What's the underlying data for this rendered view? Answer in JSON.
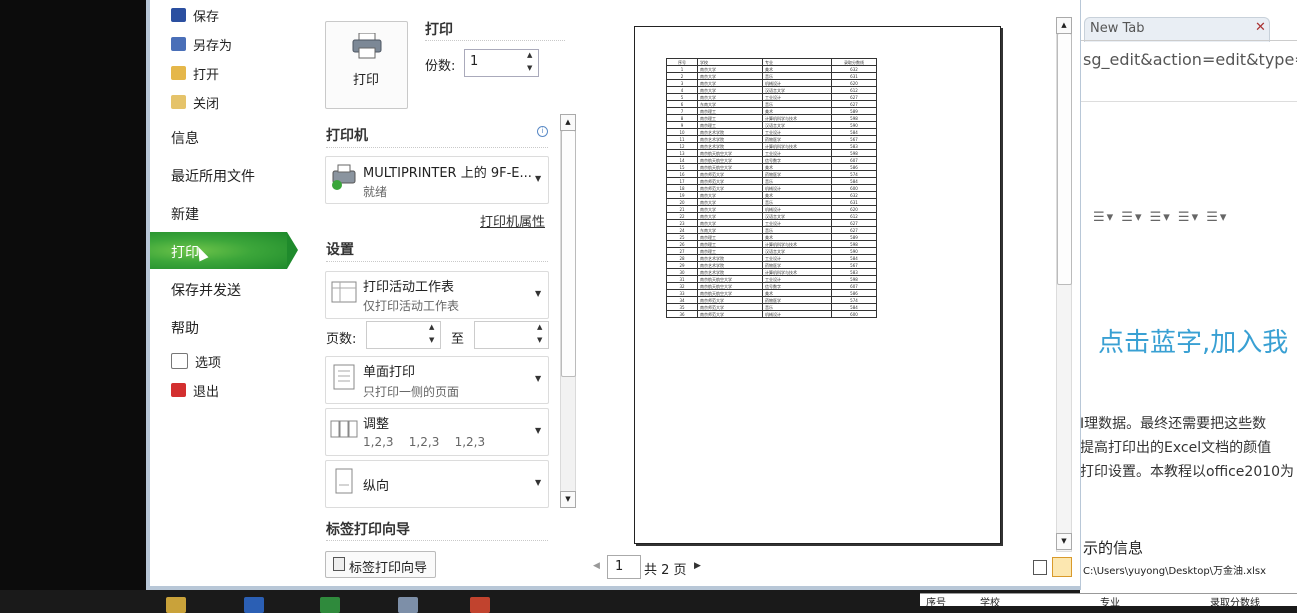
{
  "nav": {
    "save": "保存",
    "save_as": "另存为",
    "open": "打开",
    "close": "关闭",
    "info": "信息",
    "recent": "最近所用文件",
    "new": "新建",
    "print": "打印",
    "save_send": "保存并发送",
    "help": "帮助",
    "options": "选项",
    "exit": "退出"
  },
  "print": {
    "button_label": "打印",
    "header": "打印",
    "copies_label": "份数:",
    "copies_value": "1"
  },
  "printer": {
    "header": "打印机",
    "name": "MULTIPRINTER 上的 9F-E...",
    "status": "就绪",
    "properties_link": "打印机属性"
  },
  "settings": {
    "header": "设置",
    "scope_title": "打印活动工作表",
    "scope_sub": "仅打印活动工作表",
    "pages_label": "页数:",
    "pages_to": "至",
    "sides_title": "单面打印",
    "sides_sub": "只打印一侧的页面",
    "collate_title": "调整",
    "collate_sub": "1,2,3    1,2,3    1,2,3",
    "orientation_title": "纵向"
  },
  "label_wizard": {
    "header": "标签打印向导",
    "button": "标签打印向导"
  },
  "preview": {
    "current_page": "1",
    "total_pages": "共 2 页"
  },
  "background_window": {
    "tab_label": "New Tab",
    "url": "sg_edit&action=edit&type=",
    "blue_text": "点击蓝字,加入我",
    "para1": "I理数据。最终还需要把这些数",
    "para2": "提高打印出的Excel文档的颜值",
    "para3": "打印设置。本教程以office2010为",
    "info": "示的信息",
    "path": "C:\\Users\\yuyong\\Desktop\\万金油.xlsx",
    "table_headers": [
      "序号",
      "学校",
      "专业",
      "录取分数线"
    ]
  },
  "preview_table": {
    "headers": [
      "序号",
      "学校",
      "专业",
      "录取分数线"
    ],
    "rows": [
      [
        "1",
        "南京大学",
        "美术",
        "632"
      ],
      [
        "2",
        "南京大学",
        "音乐",
        "631"
      ],
      [
        "3",
        "南京大学",
        "机械设计",
        "620"
      ],
      [
        "4",
        "南京大学",
        "汉语言文学",
        "612"
      ],
      [
        "5",
        "南京大学",
        "工业设计",
        "627"
      ],
      [
        "6",
        "东南大学",
        "音乐",
        "627"
      ],
      [
        "7",
        "南京理工",
        "美术",
        "589"
      ],
      [
        "8",
        "南京理工",
        "计算机科学与技术",
        "598"
      ],
      [
        "9",
        "南京理工",
        "汉语言文学",
        "590"
      ],
      [
        "10",
        "南京艺术学院",
        "工业设计",
        "584"
      ],
      [
        "11",
        "南京艺术学院",
        "药物医学",
        "567"
      ],
      [
        "12",
        "南京艺术学院",
        "计算机科学与技术",
        "583"
      ],
      [
        "13",
        "南京航天航空大学",
        "工业设计",
        "598"
      ],
      [
        "14",
        "南京航天航空大学",
        "信号数字",
        "607"
      ],
      [
        "15",
        "南京航天航空大学",
        "美术",
        "586"
      ],
      [
        "16",
        "南京师范大学",
        "药物医学",
        "574"
      ],
      [
        "17",
        "南京师范大学",
        "音乐",
        "584"
      ],
      [
        "18",
        "南京师范大学",
        "机械设计",
        "600"
      ],
      [
        "19",
        "南京大学",
        "美术",
        "632"
      ],
      [
        "20",
        "南京大学",
        "音乐",
        "631"
      ],
      [
        "21",
        "南京大学",
        "机械设计",
        "620"
      ],
      [
        "22",
        "南京大学",
        "汉语言文学",
        "612"
      ],
      [
        "23",
        "南京大学",
        "工业设计",
        "627"
      ],
      [
        "24",
        "东南大学",
        "音乐",
        "627"
      ],
      [
        "25",
        "南京理工",
        "美术",
        "589"
      ],
      [
        "26",
        "南京理工",
        "计算机科学与技术",
        "598"
      ],
      [
        "27",
        "南京理工",
        "汉语言文学",
        "590"
      ],
      [
        "28",
        "南京艺术学院",
        "工业设计",
        "584"
      ],
      [
        "29",
        "南京艺术学院",
        "药物医学",
        "567"
      ],
      [
        "30",
        "南京艺术学院",
        "计算机科学与技术",
        "583"
      ],
      [
        "31",
        "南京航天航空大学",
        "工业设计",
        "598"
      ],
      [
        "32",
        "南京航天航空大学",
        "信号数字",
        "607"
      ],
      [
        "33",
        "南京航天航空大学",
        "美术",
        "586"
      ],
      [
        "34",
        "南京师范大学",
        "药物医学",
        "574"
      ],
      [
        "35",
        "南京师范大学",
        "音乐",
        "584"
      ],
      [
        "36",
        "南京师范大学",
        "机械设计",
        "600"
      ]
    ]
  },
  "colors": {
    "active_nav": "#3ca63a",
    "link_blue": "#39a0d3"
  }
}
